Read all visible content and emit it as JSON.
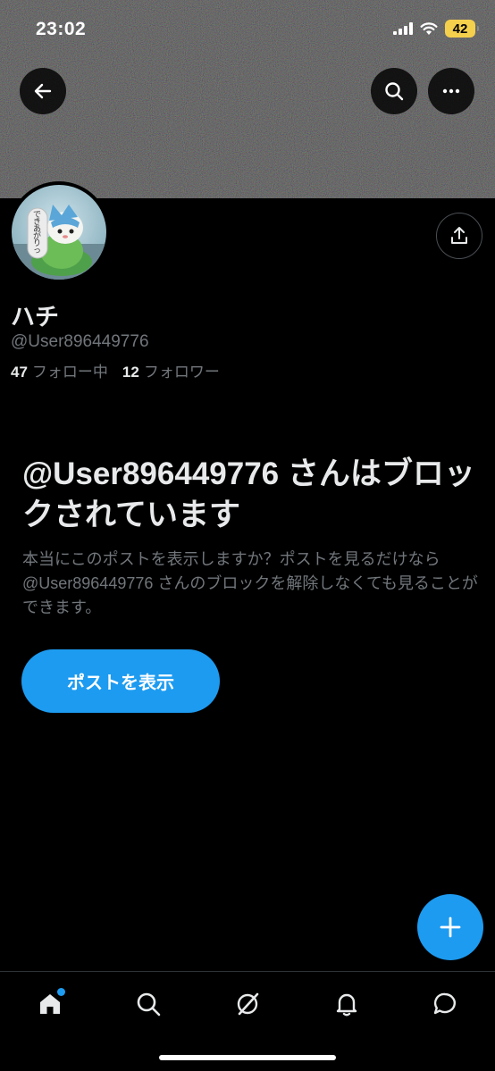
{
  "status_bar": {
    "time": "23:02",
    "battery": "42"
  },
  "profile": {
    "display_name": "ハチ",
    "handle": "@User896449776",
    "following_count": "47",
    "following_label": "フォロー中",
    "followers_count": "12",
    "followers_label": "フォロワー",
    "avatar_text": "できあがりっ"
  },
  "blocked_notice": {
    "title": "@User896449776 さんはブロックされています",
    "body": "本当にこのポストを表示しますか？ポストを見るだけなら @User896449776 さんのブロックを解除しなくても見ることができます。",
    "button_label": "ポストを表示"
  },
  "icons": {
    "back": "arrow-left-icon",
    "search": "search-icon",
    "more": "more-horizontal-icon",
    "share": "share-icon",
    "compose": "plus-icon",
    "nav": [
      "home-icon",
      "search-icon",
      "grok-icon",
      "bell-icon",
      "message-icon"
    ]
  },
  "colors": {
    "accent": "#1d9bf0",
    "background": "#000000",
    "text_primary": "#e7e9ea",
    "text_secondary": "#71767b",
    "battery": "#f5d04c"
  }
}
